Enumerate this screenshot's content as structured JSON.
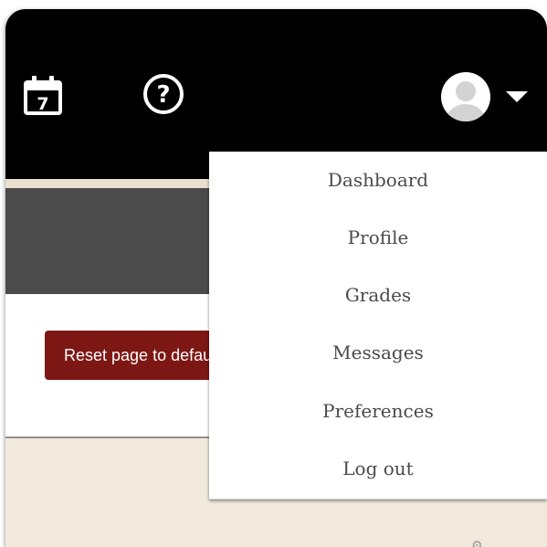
{
  "navbar": {
    "calendar_day": "7",
    "help_glyph": "?",
    "icons": [
      "calendar-icon",
      "help-icon",
      "avatar-icon",
      "caret-down-icon"
    ]
  },
  "content": {
    "reset_button_label": "Reset page to default"
  },
  "user_menu": {
    "items": [
      {
        "label": "Dashboard"
      },
      {
        "label": "Profile"
      },
      {
        "label": "Grades"
      },
      {
        "label": "Messages"
      },
      {
        "label": "Preferences"
      },
      {
        "label": "Log out"
      }
    ]
  },
  "colors": {
    "navbar": "#000000",
    "header": "#4b4b4b",
    "accent_button": "#7d1714",
    "page_background": "#f1e9dc",
    "menu_text": "#4a4a4a"
  }
}
